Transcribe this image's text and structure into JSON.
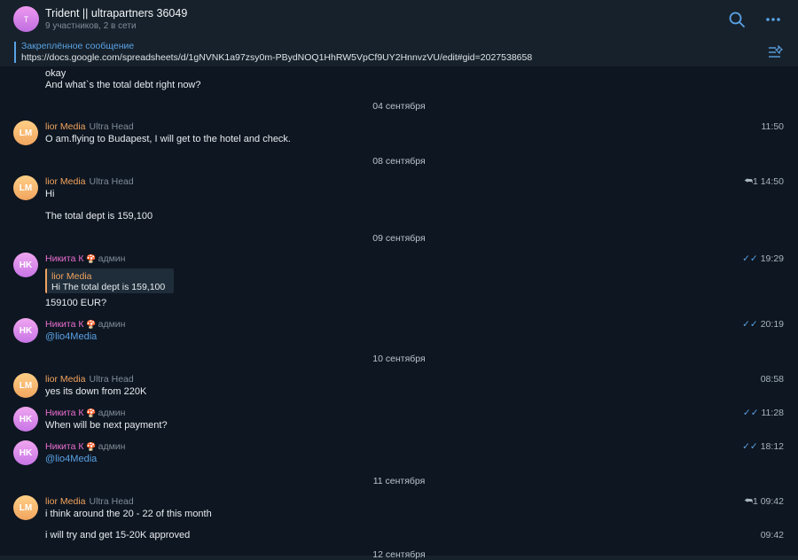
{
  "header": {
    "avatar_letter": "T",
    "title": "Trident || ultrapartners 36049",
    "subtitle": "9 участников, 2 в сети",
    "icons": [
      "search-icon",
      "more-icon"
    ]
  },
  "pinned": {
    "label": "Закреплённое сообщение",
    "text": "https://docs.google.com/spreadsheets/d/1gNVNK1a97zsy0m-PBydNOQ1HhRW5VpCf9UY2HnnvzVU/edit#gid=2027538658",
    "icon": "pinned-list-icon"
  },
  "colors": {
    "background": "#0e1621",
    "header": "#17212b",
    "accent": "#5aa2e4",
    "lior": "#f0a35e",
    "nikita": "#ea6ed0"
  },
  "top_lines": [
    "okay",
    "And what`s the total debt right now?"
  ],
  "dates": [
    "04 сентября",
    "08 сентября",
    "09 сентября",
    "10 сентября",
    "11 сентября",
    "12 сентября"
  ],
  "names": {
    "lior": "lior Media",
    "lior_role": "Ultra Head",
    "lior_initials": "LM",
    "nikita": "Никита К",
    "nikita_role": "админ",
    "nikita_initials": "HK",
    "nikita_badge": "🍄"
  },
  "messages": {
    "m1": {
      "text": "O am.flying to Budapest, I will get to the hotel and check.",
      "time": "11:50"
    },
    "m2": {
      "text1": "Hi",
      "text2": "The total dept is 159,100",
      "time": "1 14:50"
    },
    "m3": {
      "reply_name": "lior Media",
      "reply_text": "Hi  The total dept is 159,100",
      "text": "159100 EUR?",
      "time": "19:29"
    },
    "m4": {
      "text": "@lio4Media",
      "time": "20:19"
    },
    "m5": {
      "text": "yes its down from 220K",
      "time": "08:58"
    },
    "m6": {
      "text": "When will be next payment?",
      "time": "11:28"
    },
    "m7": {
      "text": "@lio4Media",
      "time": "18:12"
    },
    "m8": {
      "text1": "i think around the 20 - 22 of this month",
      "time1": "1 09:42",
      "text2": "i will try and get 15-20K approved",
      "time2": "09:42"
    }
  }
}
